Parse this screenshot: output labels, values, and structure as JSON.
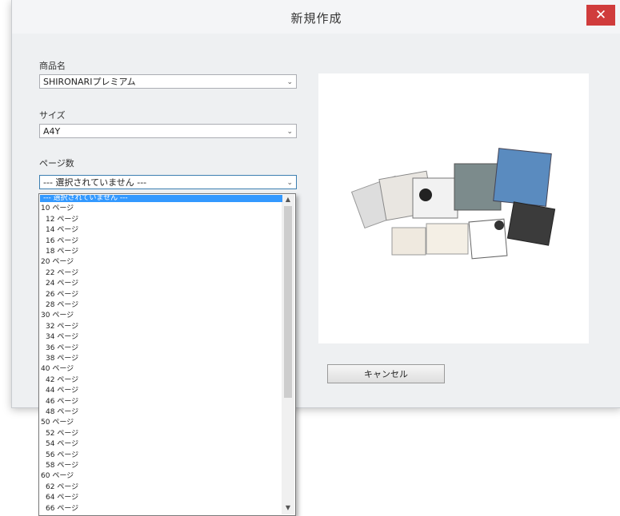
{
  "dialog": {
    "title": "新規作成",
    "close_glyph": "✕"
  },
  "product": {
    "label": "商品名",
    "value": "SHIRONARIプレミアム"
  },
  "size": {
    "label": "サイズ",
    "value": "A4Y"
  },
  "pages": {
    "label": "ページ数",
    "value": "--- 選択されていません ---"
  },
  "cancel_label": "キャンセル",
  "arrow_glyph": "⌄",
  "scroll_up_glyph": "▲",
  "scroll_down_glyph": "▼",
  "dropdown_items": [
    "--- 選択されていません ---",
    "10 ページ",
    "12 ページ",
    "14 ページ",
    "16 ページ",
    "18 ページ",
    "20 ページ",
    "22 ページ",
    "24 ページ",
    "26 ページ",
    "28 ページ",
    "30 ページ",
    "32 ページ",
    "34 ページ",
    "36 ページ",
    "38 ページ",
    "40 ページ",
    "42 ページ",
    "44 ページ",
    "46 ページ",
    "48 ページ",
    "50 ページ",
    "52 ページ",
    "54 ページ",
    "56 ページ",
    "58 ページ",
    "60 ページ",
    "62 ページ",
    "64 ページ",
    "66 ページ"
  ]
}
